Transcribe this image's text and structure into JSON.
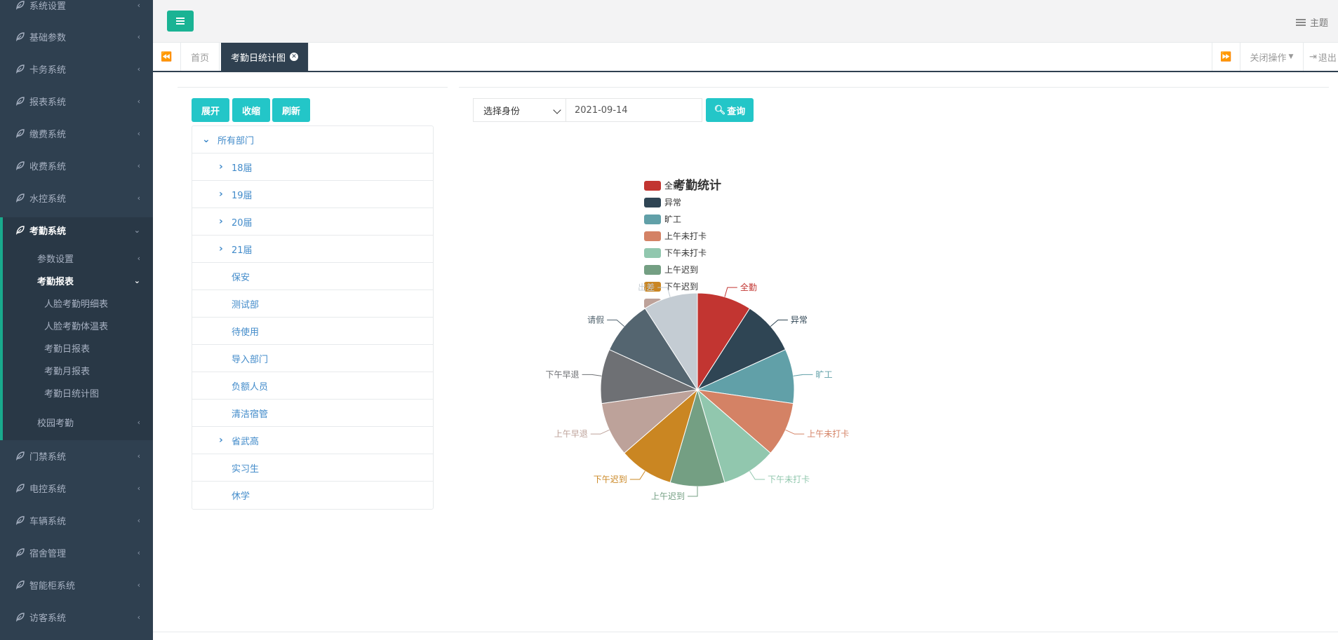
{
  "sidebar": {
    "items": [
      {
        "label": "系统设置"
      },
      {
        "label": "基础参数"
      },
      {
        "label": "卡务系统"
      },
      {
        "label": "报表系统"
      },
      {
        "label": "缴费系统"
      },
      {
        "label": "收费系统"
      },
      {
        "label": "水控系统"
      },
      {
        "label": "考勤系统"
      },
      {
        "label": "门禁系统"
      },
      {
        "label": "电控系统"
      },
      {
        "label": "车辆系统"
      },
      {
        "label": "宿舍管理"
      },
      {
        "label": "智能柜系统"
      },
      {
        "label": "访客系统"
      }
    ],
    "sub_items": [
      {
        "label": "参数设置"
      },
      {
        "label": "考勤报表"
      },
      {
        "label": "人脸考勤明细表"
      },
      {
        "label": "人脸考勤体温表"
      },
      {
        "label": "考勤日报表"
      },
      {
        "label": "考勤月报表"
      },
      {
        "label": "考勤日统计图"
      },
      {
        "label": "校园考勤"
      }
    ]
  },
  "topbar": {
    "theme_label": "主题"
  },
  "tabs": {
    "home": "首页",
    "active": "考勤日统计图",
    "close_ops": "关闭操作",
    "logout": "退出"
  },
  "toolbar": {
    "expand": "展开",
    "collapse": "收缩",
    "refresh": "刷新",
    "identity_select": "选择身份",
    "date_value": "2021-09-14",
    "query": "查询"
  },
  "tree": {
    "root": "所有部门",
    "nodes": [
      {
        "label": "18届",
        "expandable": true
      },
      {
        "label": "19届",
        "expandable": true
      },
      {
        "label": "20届",
        "expandable": true
      },
      {
        "label": "21届",
        "expandable": true
      },
      {
        "label": "保安",
        "expandable": false
      },
      {
        "label": "测试部",
        "expandable": false
      },
      {
        "label": "待使用",
        "expandable": false
      },
      {
        "label": "导入部门",
        "expandable": false
      },
      {
        "label": "负额人员",
        "expandable": false
      },
      {
        "label": "清洁宿管",
        "expandable": false
      },
      {
        "label": "省武高",
        "expandable": true
      },
      {
        "label": "实习生",
        "expandable": false
      },
      {
        "label": "休学",
        "expandable": false
      }
    ]
  },
  "chart_data": {
    "type": "pie",
    "title": "考勤统计",
    "legend_position": "top-left",
    "categories": [
      "全勤",
      "异常",
      "旷工",
      "上午未打卡",
      "下午未打卡",
      "上午迟到",
      "下午迟到",
      "上午早退",
      "下午早退",
      "请假",
      "出差"
    ],
    "values": [
      1,
      1,
      1,
      1,
      1,
      1,
      1,
      1,
      1,
      1,
      1
    ],
    "colors": [
      "#c23531",
      "#2f4554",
      "#61a0a8",
      "#d48265",
      "#91c7ae",
      "#749f83",
      "#ca8622",
      "#bda29a",
      "#6e7074",
      "#546570",
      "#c4ccd3"
    ]
  }
}
